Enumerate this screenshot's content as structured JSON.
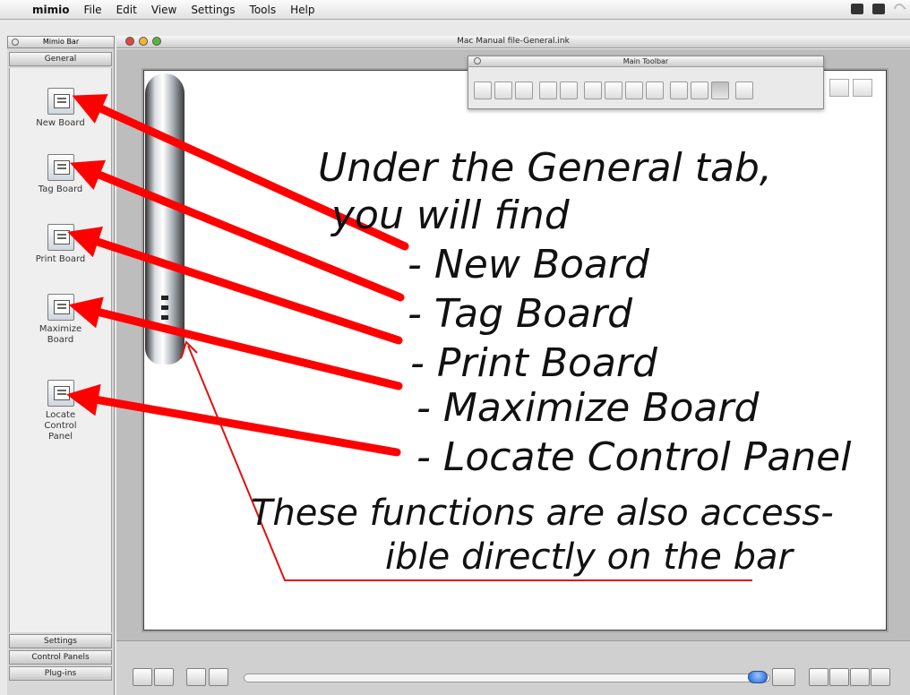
{
  "menubar": {
    "app_name": "mimio",
    "items": [
      "File",
      "Edit",
      "View",
      "Settings",
      "Tools",
      "Help"
    ]
  },
  "mimio_bar": {
    "title": "Mimio Bar",
    "tab_general": "General",
    "tools": [
      {
        "label": "New Board",
        "icon": "new-board-icon"
      },
      {
        "label": "Tag Board",
        "icon": "tag-board-icon"
      },
      {
        "label": "Print Board",
        "icon": "print-board-icon"
      },
      {
        "label": "Maximize Board",
        "icon": "maximize-board-icon"
      },
      {
        "label": "Locate Control Panel",
        "icon": "locate-control-panel-icon"
      }
    ],
    "tab_settings": "Settings",
    "tab_control_panels": "Control Panels",
    "tab_plugins": "Plug-ins"
  },
  "window": {
    "title": "Mac Manual file-General.ink"
  },
  "main_toolbar": {
    "title": "Main Toolbar"
  },
  "annotation": {
    "lines": [
      "Under the General tab,",
      "you will find",
      "- New Board",
      "- Tag Board",
      "- Print Board",
      "- Maximize Board",
      "- Locate Control Panel",
      "These functions are also access-",
      "ible directly on the bar"
    ],
    "arrow_color": "#ff0000",
    "ink_color": "#111111"
  }
}
